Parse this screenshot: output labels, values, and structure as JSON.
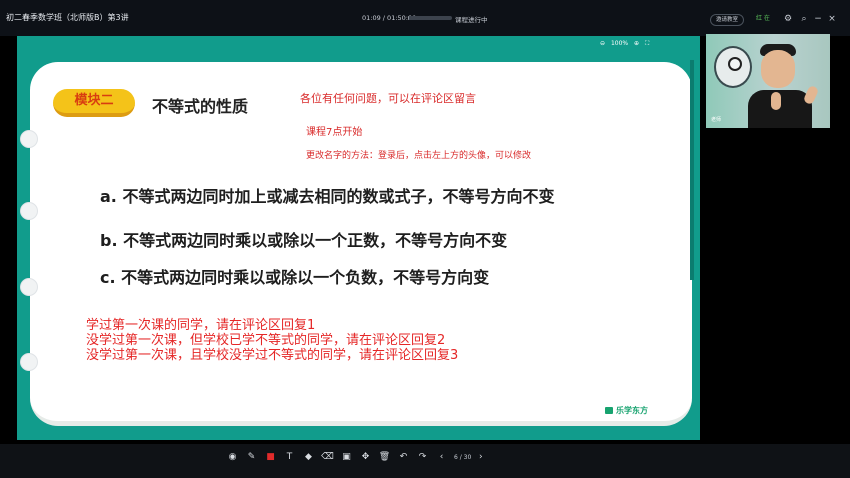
{
  "header": {
    "title": "初二春季数学班（北师版B）第3讲",
    "time": "01:09 / 01:50:00",
    "progress": 0.01,
    "status": "课程进行中",
    "teacher_button": "邀请教室",
    "live_badge": "红 在",
    "icons": [
      "settings-icon",
      "zoom-icon",
      "minimize-icon",
      "close-icon"
    ]
  },
  "whiteboard": {
    "zoom": "100%",
    "badge_label": "模块二",
    "heading": "不等式的性质",
    "notes": [
      "各位有任何问题，可以在评论区留言",
      "课程7点开始",
      "更改名字的方法：登录后，点击左上方的头像，可以修改"
    ],
    "rules": [
      "a. 不等式两边同时加上或减去相同的数或式子，不等号方向不变",
      "b. 不等式两边同时乘以或除以一个正数，不等号方向不变",
      "c. 不等式两边同时乘以或除以一个负数，不等号方向变"
    ],
    "replies": [
      "学过第一次课的同学，请在评论区回复1",
      "没学过第一次课，但学校已学不等式的同学，请在评论区回复2",
      "没学过第一次课，且学校没学过不等式的同学，请在评论区回复3"
    ],
    "logo": "乐学东方"
  },
  "toolbar": {
    "items": [
      "pointer",
      "pen",
      "color",
      "text",
      "shape",
      "eraser",
      "image",
      "move",
      "delete",
      "undo",
      "redo",
      "previous",
      "next"
    ],
    "page": "6 / 30"
  },
  "camera": {
    "label": "老师"
  }
}
